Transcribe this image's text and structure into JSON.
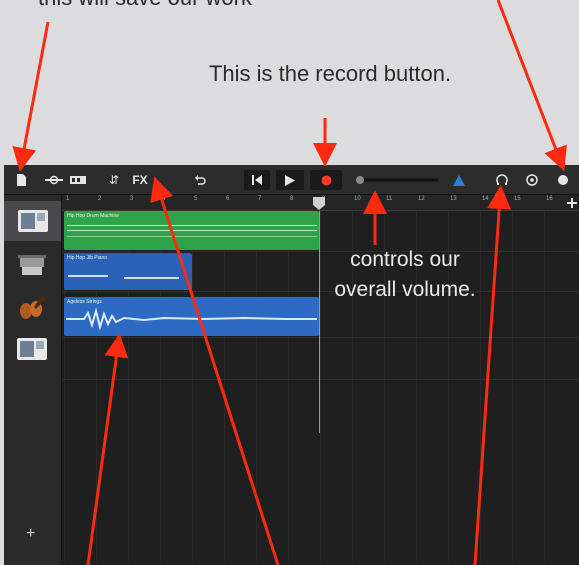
{
  "annotations": {
    "top_left": "this will save our work",
    "record": "This is the record button.",
    "volume": "controls our overall volume."
  },
  "toolbar": {
    "fx_label": "FX",
    "mixer_label": "⇵"
  },
  "sidebar": {
    "add_label": "+"
  },
  "ruler": {
    "bars": [
      "1",
      "2",
      "3",
      "4",
      "5",
      "6",
      "7",
      "8",
      "9",
      "10",
      "11",
      "12",
      "13",
      "14",
      "15",
      "16"
    ]
  },
  "tracks": [
    {
      "name": "Hip Hop Drum Machine",
      "color": "#2fa34a"
    },
    {
      "name": "Hip Hop Jib Piano",
      "color": "#2a62b8"
    },
    {
      "name": "Ageless Strings",
      "color": "#2a62b8"
    }
  ],
  "colors": {
    "record": "#ff3b30",
    "arrow": "#ff2a10",
    "green_region": "#2fa34a",
    "blue_region": "#2a62b8"
  }
}
